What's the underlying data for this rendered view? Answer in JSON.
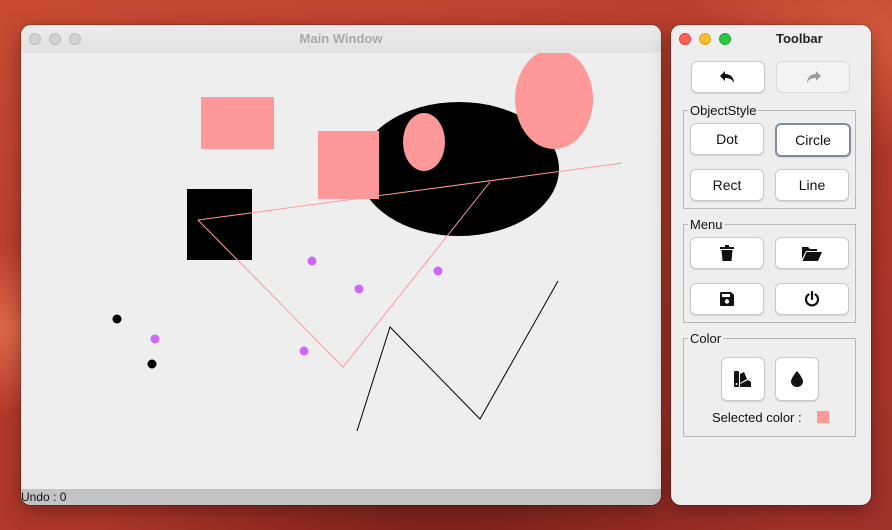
{
  "desktop": {
    "background": "#b63a2a"
  },
  "main_window": {
    "title": "Main Window",
    "status": "Undo : 0"
  },
  "toolbar_window": {
    "title": "Toolbar",
    "history": {
      "undo": {
        "icon": "undo-icon",
        "enabled": true
      },
      "redo": {
        "icon": "redo-icon",
        "enabled": false
      }
    },
    "object_style": {
      "legend": "ObjectStyle",
      "buttons": [
        "Dot",
        "Circle",
        "Rect",
        "Line"
      ],
      "selected": "Circle"
    },
    "menu": {
      "legend": "Menu",
      "buttons": [
        {
          "icon": "trash-icon",
          "action": "clear"
        },
        {
          "icon": "folder-open-icon",
          "action": "open"
        },
        {
          "icon": "floppy-disk-icon",
          "action": "save"
        },
        {
          "icon": "power-icon",
          "action": "quit"
        }
      ]
    },
    "color": {
      "legend": "Color",
      "buttons": [
        {
          "icon": "palette-icon"
        },
        {
          "icon": "droplet-icon"
        }
      ],
      "selected_label": "Selected color :",
      "selected_value": "#ff9999"
    }
  },
  "colors": {
    "accent_pink": "#ff9999",
    "dot_purple": "#cc66ff",
    "shape_black": "#000000"
  }
}
